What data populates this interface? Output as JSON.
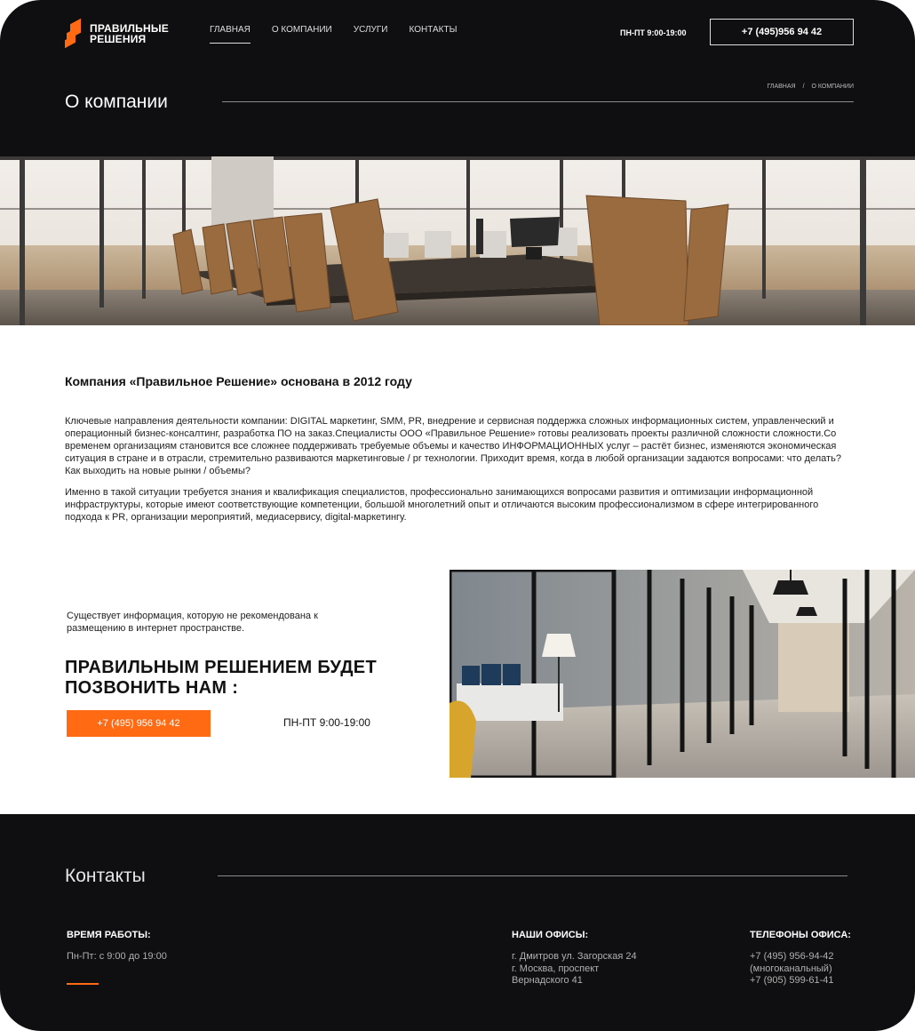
{
  "header": {
    "logo_line1": "ПРАВИЛЬНЫЕ",
    "logo_line2": "РЕШЕНИЯ",
    "nav": [
      {
        "label": "ГЛАВНАЯ"
      },
      {
        "label": "О КОМПАНИИ"
      },
      {
        "label": "УСЛУГИ"
      },
      {
        "label": "КОНТАКТЫ"
      }
    ],
    "hours": "ПН-ПТ 9:00-19:00",
    "phone": "+7 (495)956 94 42",
    "page_title": "О компании",
    "breadcrumb": {
      "home": "ГЛАВНАЯ",
      "separator": "/",
      "current": "О КОМПАНИИ"
    }
  },
  "about": {
    "heading": "Компания «Правильное Решение» основана в 2012 году",
    "paragraph1": "Ключевые направления деятельности компании: DIGITAL маркетинг, SMM, PR, внедрение и сервисная поддержка сложных информационных систем, управленческий и операционный бизнес-консалтинг, разработка ПО на заказ.Специалисты ООО «Правильное Решение» готовы реализовать проекты различной сложности сложности.Со временем организациям становится все сложнее поддерживать требуемые объемы и качество ИНФОРМАЦИОННЫХ услуг – растёт бизнес, изменяются экономическая ситуация в стране и в отрасли, стремительно развиваются маркетинговые / pr технологии. Приходит время, когда в любой организации задаются вопросами: что делать? Как выходить на новые рынки / объемы?",
    "paragraph2": "Именно в такой ситуации требуется знания и квалификация специалистов, профессионально занимающихся вопросами развития и оптимизации информационной инфраструктуры, которые имеют соответствующие компетенции, большой многолетний опыт и отличаются высоким профессионализмом в сфере интегрированного подхода к PR, организации мероприятий, медиасервису, digital-маркетингу."
  },
  "cta": {
    "note": "Существует информация, которую не рекомендована к размещению в интернет пространстве.",
    "title": "ПРАВИЛЬНЫМ РЕШЕНИЕМ БУДЕТ ПОЗВОНИТЬ НАМ :",
    "phone": "+7 (495) 956 94 42",
    "hours": "ПН-ПТ 9:00-19:00"
  },
  "footer": {
    "title": "Контакты",
    "work_title": "ВРЕМЯ РАБОТЫ:",
    "work_text": "Пн-Пт: с 9:00 до 19:00",
    "offices_title": "НАШИ ОФИСЫ:",
    "offices_line1": "г. Дмитров ул. Загорская 24",
    "offices_line2": "г. Москва, проспект",
    "offices_line3": "Вернадского 41",
    "phones_title": "ТЕЛЕФОНЫ ОФИСА:",
    "phones_line1": "+7 (495) 956-94-42",
    "phones_line2": "(многоканальный)",
    "phones_line3": "+7 (905) 599-61-41"
  },
  "colors": {
    "accent": "#ff6a13",
    "dark_bg": "#0f0f11"
  }
}
